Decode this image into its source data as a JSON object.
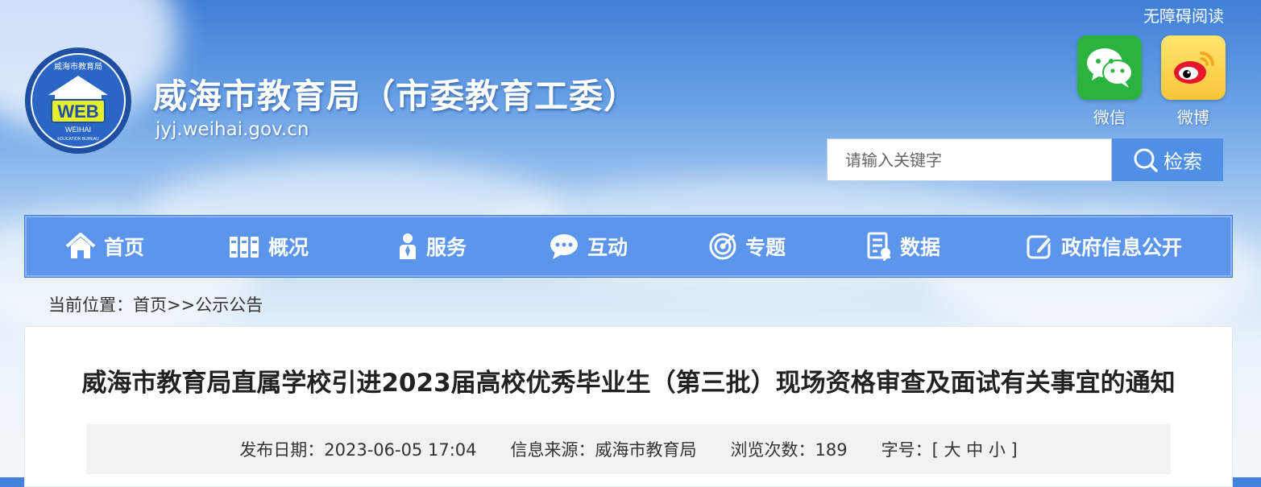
{
  "header": {
    "accessibility_label": "无障碍阅读",
    "logo": {
      "badge": "WEB",
      "ring_text": "威海市教育局",
      "sub1": "WEIHAI",
      "sub2": "EDUCATION BUREAU"
    },
    "site_title": "威海市教育局（市委教育工委）",
    "site_domain": "jyj.weihai.gov.cn",
    "social": [
      {
        "label": "微信",
        "icon": "wechat-icon",
        "color": "#2bb33f"
      },
      {
        "label": "微博",
        "icon": "weibo-icon",
        "color": "#f8c53a"
      }
    ],
    "search": {
      "placeholder": "请输入关键字",
      "button_label": "检索"
    }
  },
  "nav": {
    "items": [
      {
        "label": "首页",
        "icon": "home-icon"
      },
      {
        "label": "概况",
        "icon": "books-icon"
      },
      {
        "label": "服务",
        "icon": "person-icon"
      },
      {
        "label": "互动",
        "icon": "chat-icon"
      },
      {
        "label": "专题",
        "icon": "target-icon"
      },
      {
        "label": "数据",
        "icon": "report-icon"
      },
      {
        "label": "政府信息公开",
        "icon": "edit-icon"
      }
    ]
  },
  "breadcrumb": {
    "text": "当前位置：首页>>公示公告"
  },
  "article": {
    "title": "威海市教育局直属学校引进2023届高校优秀毕业生（第三批）现场资格审查及面试有关事宜的通知",
    "publish_date": "发布日期：2023-06-05 17:04",
    "source": "信息来源：威海市教育局",
    "views": "浏览次数：189",
    "font_size_label": "字号：[",
    "font_size_options": [
      "大",
      "中",
      "小"
    ],
    "font_size_close": "]"
  },
  "colors": {
    "nav_bg": "#5b95ec",
    "search_btn": "#4f8fe6",
    "accent": "#3e78d0"
  }
}
